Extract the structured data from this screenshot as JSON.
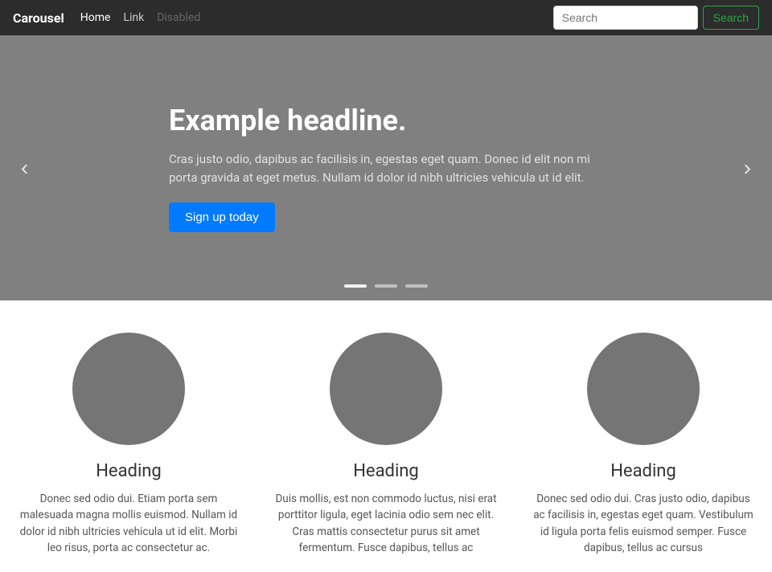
{
  "navbar": {
    "brand": "Carousel",
    "links": [
      {
        "label": "Home",
        "state": "active"
      },
      {
        "label": "Link",
        "state": "normal"
      },
      {
        "label": "Disabled",
        "state": "disabled"
      }
    ],
    "search_placeholder": "Search",
    "search_btn_label": "Search"
  },
  "carousel": {
    "title": "Example headline.",
    "text": "Cras justo odio, dapibus ac facilisis in, egestas eget quam. Donec id elit non mi porta gravida at eget metus. Nullam id dolor id nibh ultricies vehicula ut id elit.",
    "btn_label": "Sign up today",
    "prev_label": "‹",
    "next_label": "›",
    "indicators": [
      {
        "active": true
      },
      {
        "active": false
      },
      {
        "active": false
      }
    ]
  },
  "columns": [
    {
      "heading": "Heading",
      "text": "Donec sed odio dui. Etiam porta sem malesuada magna mollis euismod. Nullam id dolor id nibh ultricies vehicula ut id elit. Morbi leo risus, porta ac consectetur ac."
    },
    {
      "heading": "Heading",
      "text": "Duis mollis, est non commodo luctus, nisi erat porttitor ligula, eget lacinia odio sem nec elit. Cras mattis consectetur purus sit amet fermentum. Fusce dapibus, tellus ac"
    },
    {
      "heading": "Heading",
      "text": "Donec sed odio dui. Cras justo odio, dapibus ac facilisis in, egestas eget quam. Vestibulum id ligula porta felis euismod semper. Fusce dapibus, tellus ac cursus"
    }
  ]
}
